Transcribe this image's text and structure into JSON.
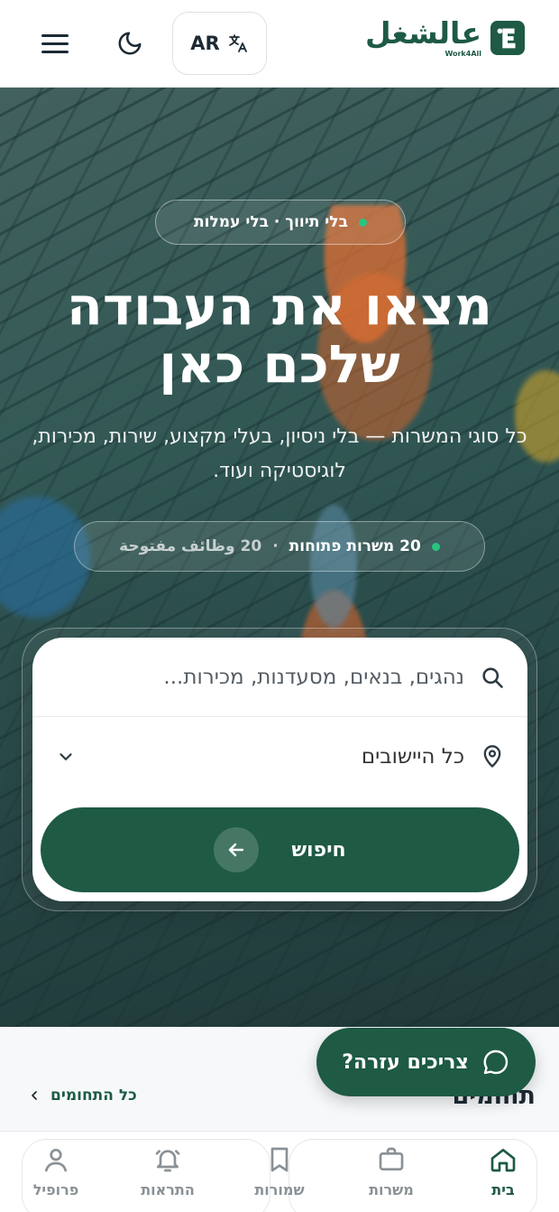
{
  "header": {
    "logo_text": "عالشغل",
    "logo_sub": "Work4All",
    "lang_label": "AR"
  },
  "hero": {
    "badge": "בלי תיווך · בלי עמלות",
    "headline_line1": "מצאו את העבודה",
    "headline_line2": "שלכם כאן",
    "subtext": "כל סוגי המשרות — בלי ניסיון, בעלי מקצוע, שירות, מכירות, לוגיסטיקה ועוד.",
    "stats_jobs": "20 משרות פתוחות",
    "stats_openings": "20 وظائف مفتوحة",
    "stats_separator": "·"
  },
  "search": {
    "placeholder": "נהגים, בנאים, מסעדנות, מכירות...",
    "location_value": "כל היישובים",
    "button_label": "חיפוש"
  },
  "help": {
    "label": "צריכים עזרה?"
  },
  "categories": {
    "title": "תחומים",
    "all_link": "כל התחומים"
  },
  "nav": {
    "home": "בית",
    "jobs": "משרות",
    "saved": "שמורות",
    "alerts": "התראות",
    "profile": "פרופיל"
  },
  "colors": {
    "brand": "#1e5a44",
    "accent_dot": "#28c57f"
  }
}
